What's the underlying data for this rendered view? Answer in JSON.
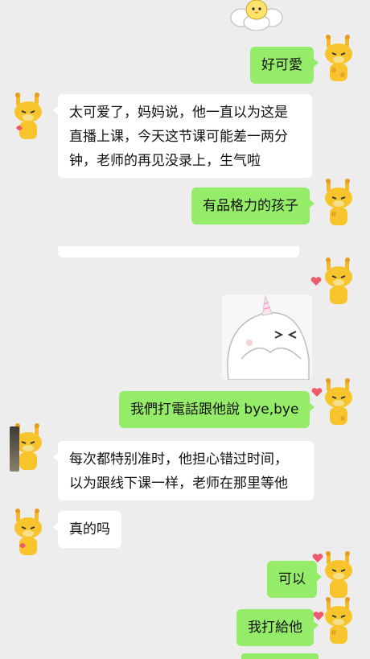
{
  "messages": [
    {
      "id": "m1",
      "side": "right",
      "text": "好可愛"
    },
    {
      "id": "m2",
      "side": "left",
      "text": "太可爱了，妈妈说，他一直以为这是\n直播上课，今天这节课可能差一两分\n钟，老师的再见没录上，生气啦"
    },
    {
      "id": "m3",
      "side": "right",
      "text": "有品格力的孩子"
    },
    {
      "id": "m4",
      "side": "right",
      "text": "我們打電話跟他說 bye,bye"
    },
    {
      "id": "m5",
      "side": "left",
      "text": "每次都特别准时，他担心错过时间，\n以为跟线下课一样，老师在那里等他"
    },
    {
      "id": "m6",
      "side": "left",
      "text": "真的吗"
    },
    {
      "id": "m7",
      "side": "right",
      "text": "可以"
    },
    {
      "id": "m8",
      "side": "right",
      "text": "我打給他"
    }
  ],
  "colors": {
    "sent_bubble": "#95ec69",
    "received_bubble": "#ffffff",
    "background": "#ededed",
    "avatar_yellow": "#f7c52b"
  },
  "stickers": [
    "sticker-chick-flower",
    "sticker-ghost-unicorn"
  ],
  "icons": [
    "giraffe-avatar-icon",
    "heart-icon"
  ]
}
